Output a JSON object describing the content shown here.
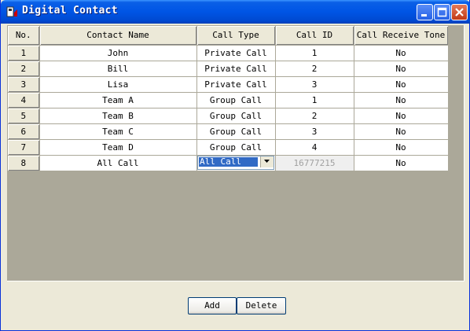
{
  "window": {
    "title": "Digital Contact"
  },
  "table": {
    "headers": [
      "No.",
      "Contact Name",
      "Call Type",
      "Call ID",
      "Call Receive Tone"
    ],
    "rows": [
      [
        "1",
        "John",
        "Private Call",
        "1",
        "No"
      ],
      [
        "2",
        "Bill",
        "Private Call",
        "2",
        "No"
      ],
      [
        "3",
        "Lisa",
        "Private Call",
        "3",
        "No"
      ],
      [
        "4",
        "Team A",
        "Group Call",
        "1",
        "No"
      ],
      [
        "5",
        "Team B",
        "Group Call",
        "2",
        "No"
      ],
      [
        "6",
        "Team C",
        "Group Call",
        "3",
        "No"
      ],
      [
        "7",
        "Team D",
        "Group Call",
        "4",
        "No"
      ]
    ],
    "editing_row": {
      "no": "8",
      "name": "All Call",
      "call_type": "All Call",
      "call_id": "16777215",
      "receive_tone": "No"
    }
  },
  "buttons": {
    "add": "Add",
    "delete": "Delete"
  }
}
